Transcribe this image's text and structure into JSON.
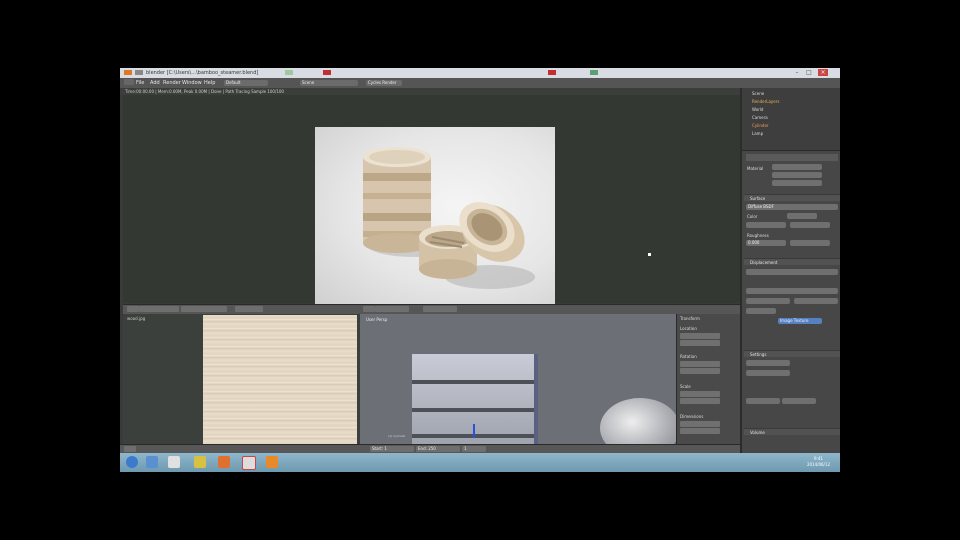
{
  "window": {
    "title": "blender [C:\\Users\\...\\bamboo_steamer.blend]"
  },
  "header": {
    "menus": [
      "File",
      "Add",
      "Render",
      "Window",
      "Help"
    ],
    "layout_value": "Default",
    "scene_value": "Scene",
    "engine_value": "Cycles Render"
  },
  "info_line": "Time:00:00.00 | Mem:0.00M, Peak 0.00M | Done | Path Tracing Sample 100/100",
  "uv_editor": {
    "image_name": "wood.jpg"
  },
  "view3d": {
    "label": "User Persp",
    "object_label": "(1) Cylinder"
  },
  "npanel": {
    "labels": [
      "Transform",
      "Location",
      "Rotation",
      "Scale",
      "Dimensions"
    ]
  },
  "outliner": {
    "rows": [
      "Scene",
      "RenderLayers",
      "World",
      "Camera",
      "Cylinder",
      "Lamp"
    ]
  },
  "properties": {
    "labels": [
      "Material",
      "Surface",
      "Color",
      "Roughness",
      "Displacement",
      "Settings",
      "Volume"
    ],
    "surface_value": "Diffuse BSDF",
    "color_value": "Image Texture",
    "roughness_value": "0.000"
  },
  "timeline": {
    "start": "Start: 1",
    "end": "End: 250",
    "frame": "1"
  },
  "taskbar": {
    "time": "9:41",
    "date": "2014/06/12"
  }
}
